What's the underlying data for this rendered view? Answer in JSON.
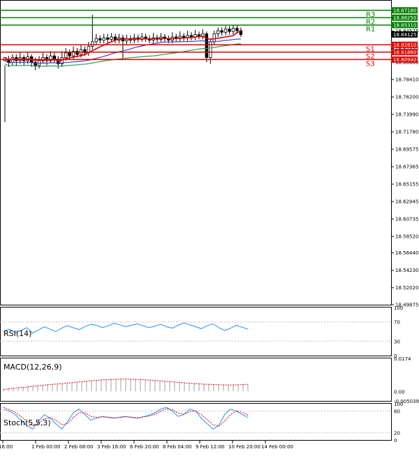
{
  "chart_data": [
    {
      "type": "candlestick",
      "ylim": [
        18.49875,
        18.884
      ],
      "y_ticks": [
        "18.84575",
        "18.82350",
        "18.80600",
        "18.78410",
        "18.76200",
        "18.73990",
        "18.71780",
        "18.69575",
        "18.67365",
        "18.65155",
        "18.62945",
        "18.60735",
        "18.58520",
        "18.56440",
        "18.54230",
        "18.52020",
        "18.49875"
      ],
      "x_ticks": [
        "16:00",
        "1 Feb 00:00",
        "2 Feb 08:00",
        "3 Feb 16:00",
        "6 Feb 20:00",
        "8 Feb 04:00",
        "9 Feb 12:00",
        "10 Feb 20:00",
        "14 Feb 00:00"
      ],
      "levels": [
        {
          "name": "R3",
          "value": 18.8718,
          "label": "18.87180",
          "color": "#008000"
        },
        {
          "name": "R2",
          "value": 18.8625,
          "label": "18.86250",
          "color": "#008000"
        },
        {
          "name": "R1",
          "value": 18.8531,
          "label": "18.85310",
          "color": "#008000"
        },
        {
          "name": "S1",
          "value": 18.8281,
          "label": "18.82810",
          "color": "#e00000"
        },
        {
          "name": "S2",
          "value": 18.8188,
          "label": "18.81880",
          "color": "#e00000"
        },
        {
          "name": "S3",
          "value": 18.8094,
          "label": "18.80940",
          "color": "#e00000"
        }
      ],
      "current_price": {
        "value": 18.84125,
        "label": "18.84125"
      },
      "candles": [
        [
          18.808,
          18.812,
          18.802,
          18.73
        ],
        [
          18.81,
          18.806,
          18.814,
          18.8
        ],
        [
          18.806,
          18.812,
          18.816,
          18.802
        ],
        [
          18.812,
          18.808,
          18.816,
          18.802
        ],
        [
          18.808,
          18.812,
          18.818,
          18.804
        ],
        [
          18.812,
          18.808,
          18.815,
          18.802
        ],
        [
          18.808,
          18.813,
          18.818,
          18.804
        ],
        [
          18.813,
          18.806,
          18.816,
          18.8
        ],
        [
          18.806,
          18.802,
          18.812,
          18.796
        ],
        [
          18.802,
          18.808,
          18.814,
          18.798
        ],
        [
          18.808,
          18.812,
          18.818,
          18.804
        ],
        [
          18.812,
          18.808,
          18.816,
          18.802
        ],
        [
          18.808,
          18.814,
          18.82,
          18.805
        ],
        [
          18.814,
          18.81,
          18.818,
          18.806
        ],
        [
          18.81,
          18.804,
          18.814,
          18.798
        ],
        [
          18.804,
          18.812,
          18.82,
          18.8
        ],
        [
          18.812,
          18.818,
          18.824,
          18.808
        ],
        [
          18.818,
          18.814,
          18.822,
          18.81
        ],
        [
          18.814,
          18.82,
          18.826,
          18.81
        ],
        [
          18.82,
          18.816,
          18.824,
          18.812
        ],
        [
          18.816,
          18.822,
          18.828,
          18.812
        ],
        [
          18.822,
          18.818,
          18.826,
          18.814
        ],
        [
          18.818,
          18.826,
          18.832,
          18.814
        ],
        [
          18.826,
          18.832,
          18.866,
          18.822
        ],
        [
          18.832,
          18.836,
          18.842,
          18.828
        ],
        [
          18.836,
          18.834,
          18.84,
          18.83
        ],
        [
          18.834,
          18.837,
          18.842,
          18.83
        ],
        [
          18.837,
          18.835,
          18.842,
          18.831
        ],
        [
          18.835,
          18.838,
          18.843,
          18.832
        ],
        [
          18.838,
          18.834,
          18.842,
          18.83
        ],
        [
          18.834,
          18.837,
          18.842,
          18.83
        ],
        [
          18.837,
          18.833,
          18.841,
          18.81
        ],
        [
          18.833,
          18.836,
          18.841,
          18.829
        ],
        [
          18.836,
          18.834,
          18.84,
          18.83
        ],
        [
          18.834,
          18.837,
          18.842,
          18.83
        ],
        [
          18.837,
          18.835,
          18.841,
          18.831
        ],
        [
          18.835,
          18.838,
          18.843,
          18.832
        ],
        [
          18.838,
          18.836,
          18.842,
          18.832
        ],
        [
          18.836,
          18.834,
          18.84,
          18.83
        ],
        [
          18.834,
          18.837,
          18.843,
          18.83
        ],
        [
          18.837,
          18.835,
          18.841,
          18.831
        ],
        [
          18.835,
          18.838,
          18.843,
          18.832
        ],
        [
          18.838,
          18.836,
          18.842,
          18.832
        ],
        [
          18.836,
          18.834,
          18.84,
          18.83
        ],
        [
          18.834,
          18.838,
          18.844,
          18.83
        ],
        [
          18.838,
          18.836,
          18.842,
          18.832
        ],
        [
          18.836,
          18.839,
          18.845,
          18.832
        ],
        [
          18.839,
          18.837,
          18.843,
          18.833
        ],
        [
          18.837,
          18.84,
          18.846,
          18.833
        ],
        [
          18.84,
          18.838,
          18.844,
          18.834
        ],
        [
          18.838,
          18.841,
          18.847,
          18.834
        ],
        [
          18.841,
          18.839,
          18.845,
          18.835
        ],
        [
          18.839,
          18.842,
          18.848,
          18.835
        ],
        [
          18.842,
          18.812,
          18.845,
          18.806
        ],
        [
          18.812,
          18.832,
          18.836,
          18.804
        ],
        [
          18.832,
          18.842,
          18.846,
          18.828
        ],
        [
          18.842,
          18.846,
          18.85,
          18.838
        ],
        [
          18.846,
          18.844,
          18.85,
          18.84
        ],
        [
          18.844,
          18.848,
          18.852,
          18.84
        ],
        [
          18.848,
          18.845,
          18.852,
          18.841
        ],
        [
          18.845,
          18.849,
          18.853,
          18.841
        ],
        [
          18.849,
          18.846,
          18.853,
          18.842
        ],
        [
          18.846,
          18.841,
          18.85,
          18.838
        ]
      ]
    },
    {
      "type": "line",
      "title": "RSI(14)",
      "ylim": [
        0,
        100
      ],
      "y_ticks": [
        "100",
        "70",
        "30",
        "0"
      ],
      "values": [
        50,
        55,
        48,
        52,
        58,
        47,
        53,
        60,
        55,
        50,
        57,
        62,
        58,
        54,
        60,
        65,
        63,
        58,
        62,
        67,
        64,
        60,
        63,
        66,
        62,
        58,
        61,
        65,
        60,
        57,
        63,
        68,
        64,
        60,
        56,
        62,
        66,
        58,
        52,
        57,
        63,
        59,
        55
      ]
    },
    {
      "type": "bar",
      "title": "MACD(12,26,9)",
      "ylim": [
        -0.005039,
        0.0174
      ],
      "y_ticks": [
        "0.0174",
        "0.00",
        "-0.005039"
      ],
      "histogram": [
        0.0012,
        0.0015,
        0.0018,
        0.002,
        0.0022,
        0.0025,
        0.0028,
        0.003,
        0.0033,
        0.0036,
        0.0038,
        0.004,
        0.0042,
        0.0045,
        0.0048,
        0.005,
        0.0052,
        0.0055,
        0.0058,
        0.006,
        0.0062,
        0.0064,
        0.0066,
        0.0067,
        0.0068,
        0.0068,
        0.0067,
        0.0066,
        0.0065,
        0.0063,
        0.0061,
        0.0059,
        0.0057,
        0.0055,
        0.0053,
        0.0051,
        0.0049,
        0.0047,
        0.0045,
        0.0043,
        0.0041,
        0.004,
        0.0038,
        0.0037,
        0.0036,
        0.0035,
        0.0034,
        0.0034,
        0.0035,
        0.0036,
        0.0037
      ],
      "signal": [
        0.001,
        0.0013,
        0.0016,
        0.0019,
        0.0021,
        0.0024,
        0.0027,
        0.003,
        0.0032,
        0.0035,
        0.0037,
        0.0039,
        0.0041,
        0.0044,
        0.0046,
        0.0049,
        0.0051,
        0.0053,
        0.0056,
        0.0058,
        0.006,
        0.0062,
        0.0063,
        0.0064,
        0.0065,
        0.0065,
        0.0064,
        0.0063,
        0.0062,
        0.0061,
        0.0059,
        0.0057,
        0.0055,
        0.0053,
        0.0051,
        0.0049,
        0.0047,
        0.0045,
        0.0043,
        0.0041,
        0.004,
        0.0038,
        0.0037,
        0.0036,
        0.0035,
        0.0034,
        0.0034,
        0.0034,
        0.0035,
        0.0036,
        0.0037
      ]
    },
    {
      "type": "line",
      "title": "Stoch(5,5,3)",
      "ylim": [
        0,
        100
      ],
      "y_ticks": [
        "100",
        "80",
        "20",
        "0"
      ],
      "k": [
        85,
        80,
        70,
        55,
        40,
        30,
        50,
        70,
        60,
        45,
        30,
        50,
        75,
        85,
        70,
        55,
        60,
        65,
        62,
        60,
        63,
        65,
        62,
        60,
        64,
        68,
        75,
        85,
        90,
        80,
        65,
        70,
        85,
        80,
        60,
        45,
        30,
        40,
        70,
        85,
        80,
        70,
        62
      ],
      "d": [
        90,
        84,
        76,
        65,
        52,
        40,
        45,
        58,
        62,
        55,
        42,
        45,
        62,
        75,
        75,
        65,
        62,
        64,
        63,
        61,
        62,
        64,
        63,
        61,
        63,
        66,
        71,
        79,
        86,
        84,
        74,
        71,
        78,
        80,
        70,
        56,
        42,
        38,
        52,
        70,
        80,
        76,
        68
      ]
    }
  ]
}
